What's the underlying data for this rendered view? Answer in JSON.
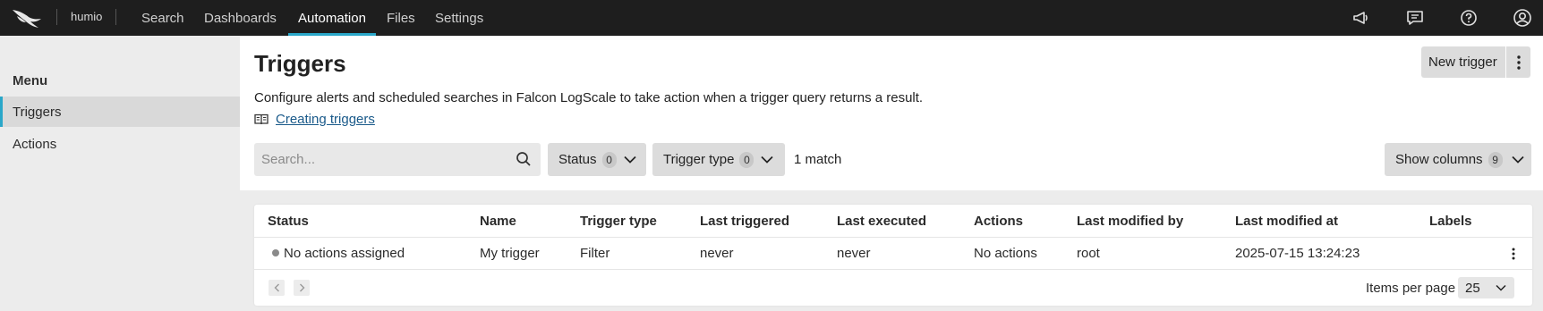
{
  "topbar": {
    "repo": "humio",
    "nav": [
      "Search",
      "Dashboards",
      "Automation",
      "Files",
      "Settings"
    ],
    "active_nav": "Automation",
    "icons": [
      "announcement-icon",
      "feedback-icon",
      "help-icon",
      "account-icon"
    ]
  },
  "sidebar": {
    "title": "Menu",
    "items": [
      {
        "label": "Triggers",
        "active": true
      },
      {
        "label": "Actions",
        "active": false
      }
    ]
  },
  "main": {
    "title": "Triggers",
    "description": "Configure alerts and scheduled searches in Falcon LogScale to take action when a trigger query returns a result.",
    "help_link": "Creating triggers",
    "new_trigger_label": "New trigger",
    "search": {
      "placeholder": "Search...",
      "value": ""
    },
    "filters": {
      "status": {
        "label": "Status",
        "count": "0"
      },
      "trigger_type": {
        "label": "Trigger type",
        "count": "0"
      }
    },
    "match_count": "1 match",
    "show_columns": {
      "label": "Show columns",
      "count": "9"
    }
  },
  "table": {
    "columns": [
      "Status",
      "Name",
      "Trigger type",
      "Last triggered",
      "Last executed",
      "Actions",
      "Last modified by",
      "Last modified at",
      "Labels"
    ],
    "rows": [
      {
        "status": "No actions assigned",
        "name": "My trigger",
        "trigger_type": "Filter",
        "last_triggered": "never",
        "last_executed": "never",
        "actions": "No actions",
        "last_modified_by": "root",
        "last_modified_at": "2025-07-15 13:24:23",
        "labels": ""
      }
    ],
    "items_per_page_label": "Items per page",
    "items_per_page": "25"
  },
  "colors": {
    "accent": "#2aa7c9",
    "topbar_bg": "#1e1e1e",
    "status_dot": "#8a8a8a"
  }
}
